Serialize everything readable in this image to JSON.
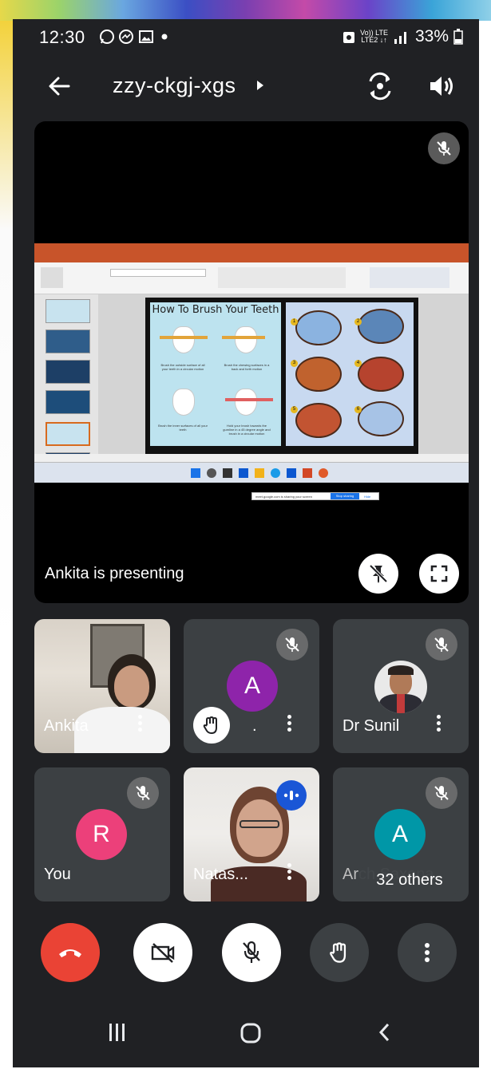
{
  "status_bar": {
    "time": "12:30",
    "battery": "33%",
    "network_top": "Vo)) LTE",
    "network_bottom": "LTE2 ↓↑",
    "icons": [
      "whatsapp-icon",
      "messenger-icon",
      "gallery-icon",
      "dot-icon",
      "alarm-icon",
      "signal-icon",
      "battery-icon"
    ]
  },
  "app_bar": {
    "meeting_code": "zzy-ckgj-xgs",
    "icons": [
      "back-arrow-icon",
      "caret-right-icon",
      "switch-camera-icon",
      "speaker-icon"
    ]
  },
  "presentation": {
    "presenter_label": "Ankita is presenting",
    "slide_title": "How To Brush Your Teeth",
    "share_notice": "meet.google.com is sharing your screen",
    "share_stop": "Stop sharing",
    "share_hide": "Hide",
    "captions": [
      "Brush the outside surface of all your teeth in a circular motion",
      "Brush the chewing surfaces in a back and forth motion",
      "Brush the inner surfaces of all your teeth",
      "Hold your brush towards the gumline in a 45 degree angle and brush in a circular motion"
    ],
    "step_numbers": [
      "1",
      "2",
      "3",
      "4",
      "5",
      "6"
    ]
  },
  "participants": [
    {
      "name": "Ankita",
      "type": "video",
      "muted": false
    },
    {
      "name": ".",
      "initial": "A",
      "avatar_color": "#8e24aa",
      "muted": true,
      "hand_raised": true
    },
    {
      "name": "Dr Sunil",
      "type": "photo",
      "muted": true
    },
    {
      "name": "You",
      "initial": "R",
      "avatar_color": "#ec407a",
      "muted": true
    },
    {
      "name": "Natas...",
      "type": "video",
      "speaking": true
    },
    {
      "name": "Arch Saxena",
      "initial": "A",
      "avatar_color": "#0097a7",
      "muted": true
    }
  ],
  "others_count_label": "32 others",
  "controls": {
    "end_call_color": "#ea4335",
    "icons": [
      "end-call-icon",
      "camera-off-icon",
      "mic-off-icon",
      "raise-hand-icon",
      "more-options-icon"
    ]
  },
  "nav_bar": {
    "icons": [
      "recent-apps-icon",
      "home-icon",
      "back-icon"
    ]
  }
}
